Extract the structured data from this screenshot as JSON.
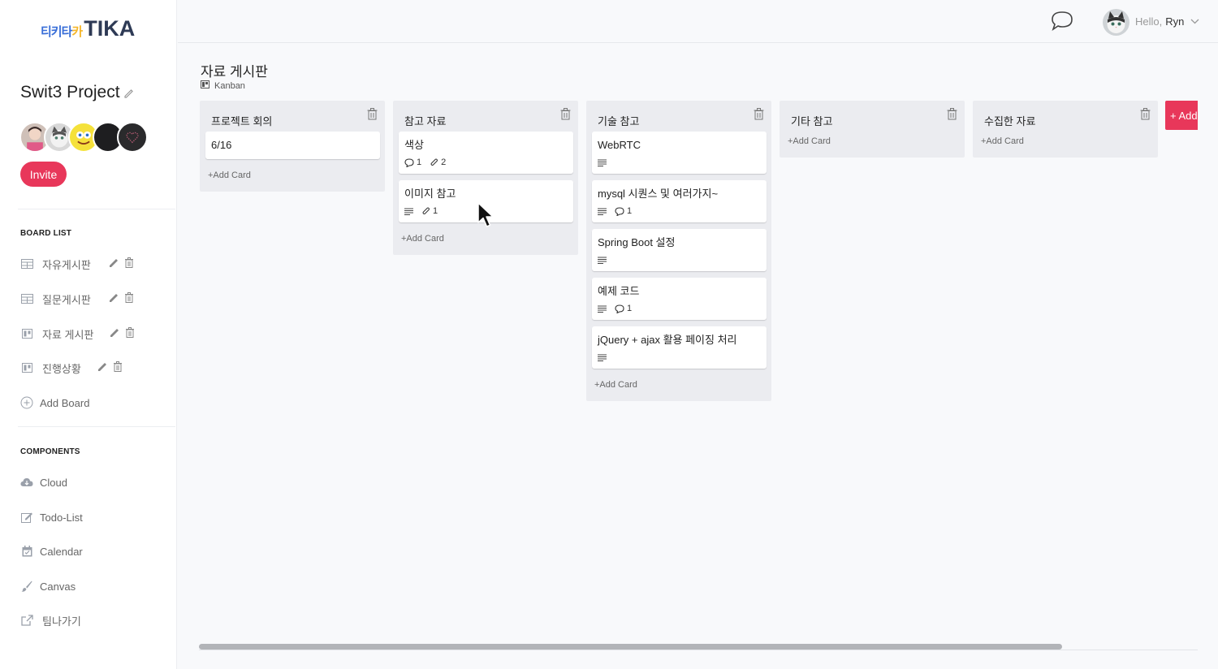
{
  "app": {
    "logo_korean": "티키타",
    "logo_korean_accent": "카",
    "logo_text": "TIKA"
  },
  "sidebar": {
    "project_title": "Swit3 Project",
    "invite_label": "Invite",
    "board_list_heading": "BOARD LIST",
    "boards": [
      {
        "label": "자유게시판",
        "icon": "table-icon"
      },
      {
        "label": "질문게시판",
        "icon": "table-icon"
      },
      {
        "label": "자료 게시판",
        "icon": "kanban-icon"
      },
      {
        "label": "진행상황",
        "icon": "kanban-icon"
      }
    ],
    "add_board_label": "Add Board",
    "components_heading": "COMPONENTS",
    "components": [
      {
        "label": "Cloud",
        "icon": "cloud-icon"
      },
      {
        "label": "Todo-List",
        "icon": "edit-icon"
      },
      {
        "label": "Calendar",
        "icon": "calendar-icon"
      },
      {
        "label": "Canvas",
        "icon": "brush-icon"
      },
      {
        "label": "팀나가기",
        "icon": "exit-icon"
      }
    ]
  },
  "header": {
    "greeting": "Hello,",
    "user_name": "Ryn"
  },
  "board": {
    "title": "자료 게시판",
    "type_label": "Kanban",
    "add_card_label": "+Add Card",
    "add_list_label": "+ Add",
    "columns": [
      {
        "title": "프로젝트 회의",
        "cards": [
          {
            "title": "6/16"
          }
        ]
      },
      {
        "title": "참고 자료",
        "cards": [
          {
            "title": "색상",
            "comments": "1",
            "attachments": "2"
          },
          {
            "title": "이미지 참고",
            "description": true,
            "attachments": "1"
          }
        ]
      },
      {
        "title": "기술 참고",
        "cards": [
          {
            "title": "WebRTC",
            "description": true
          },
          {
            "title": "mysql 시퀀스 및 여러가지~",
            "description": true,
            "comments": "1"
          },
          {
            "title": "Spring Boot 설정",
            "description": true
          },
          {
            "title": "예제 코드",
            "description": true,
            "comments": "1"
          },
          {
            "title": "jQuery + ajax 활용 페이징 처리",
            "description": true
          }
        ]
      },
      {
        "title": "기타 참고",
        "cards": []
      },
      {
        "title": "수집한 자료",
        "cards": []
      }
    ]
  },
  "colors": {
    "accent": "#e8375a",
    "column_bg": "#ebecf0",
    "logo_blue": "#3a6fd8",
    "logo_yellow": "#f5b62a",
    "logo_navy": "#2e3a55"
  }
}
